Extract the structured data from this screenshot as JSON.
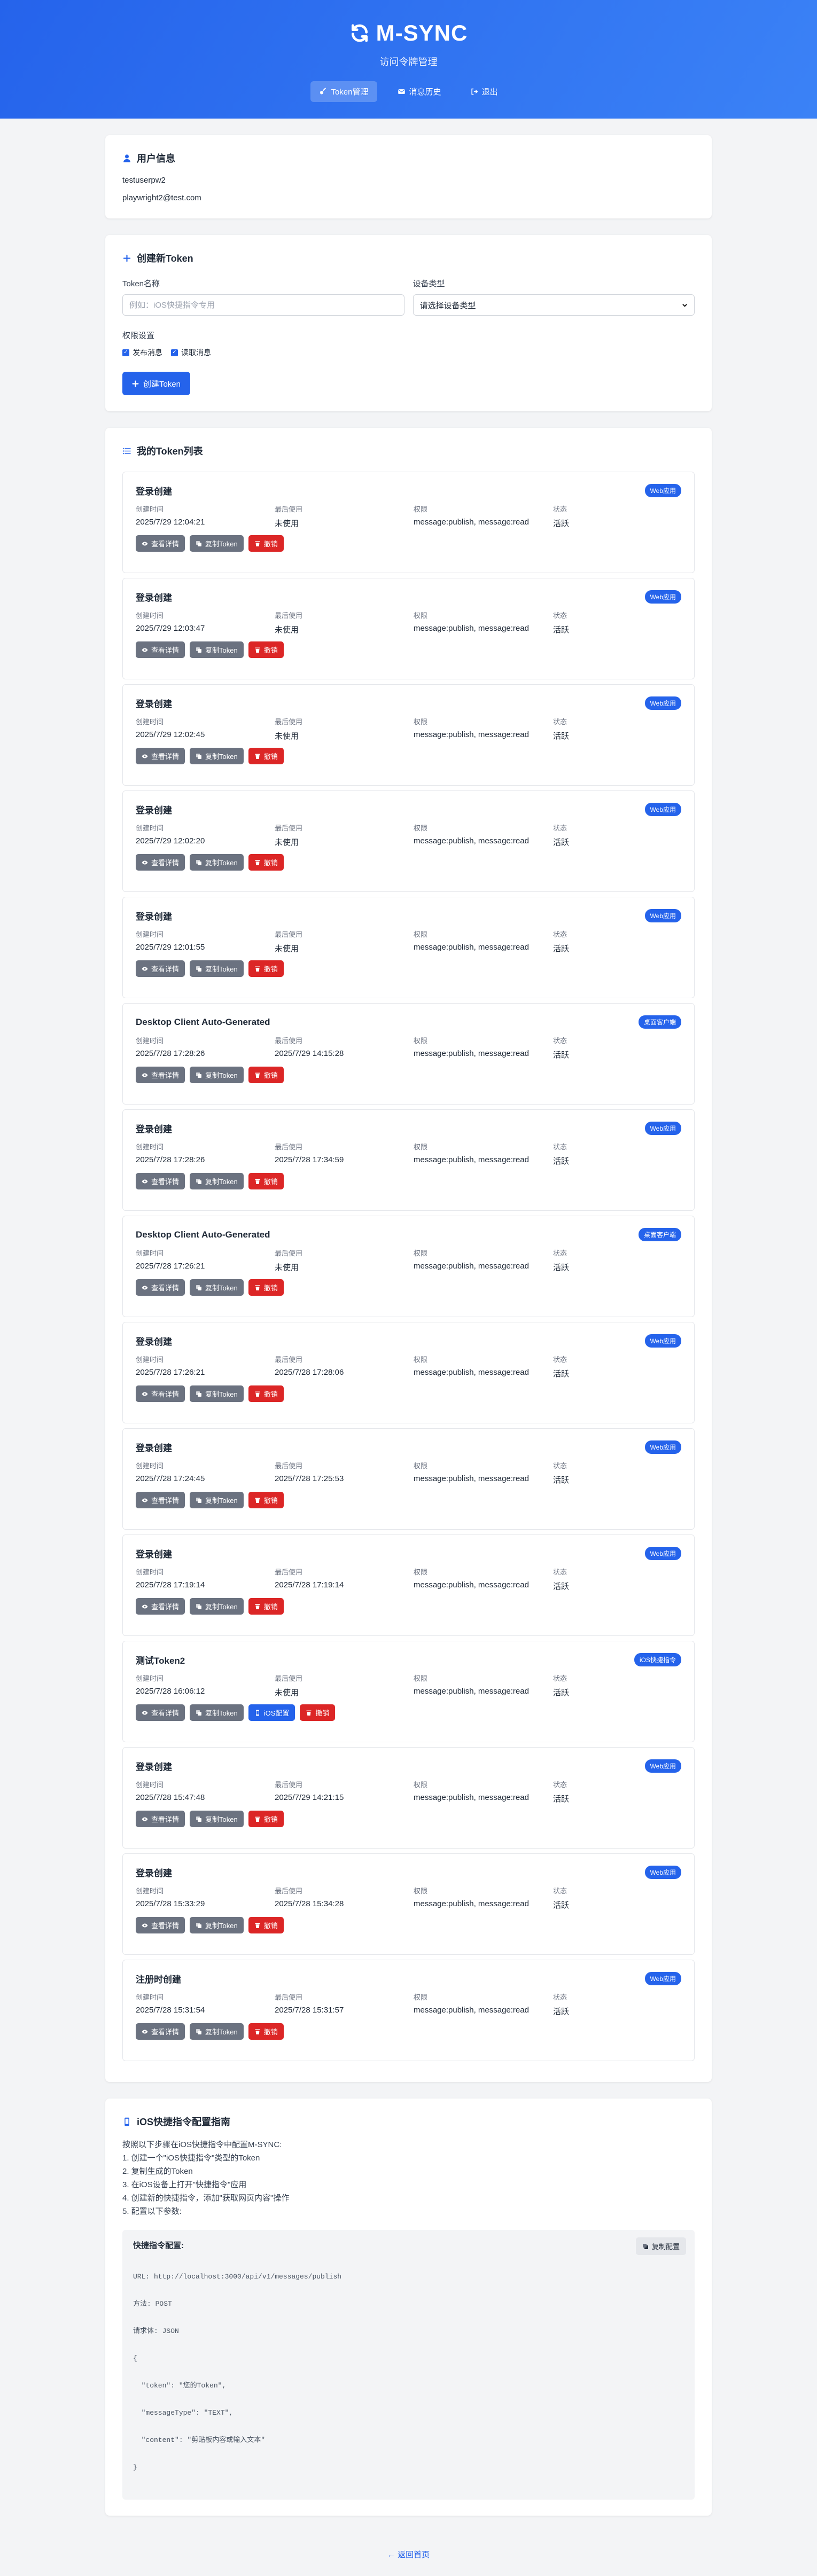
{
  "brand": {
    "name": "M-SYNC",
    "subtitle": "访问令牌管理"
  },
  "nav": {
    "items": [
      {
        "label": "Token管理",
        "icon": "key-icon",
        "active": true
      },
      {
        "label": "消息历史",
        "icon": "envelope-icon",
        "active": false
      },
      {
        "label": "退出",
        "icon": "logout-icon",
        "active": false
      }
    ]
  },
  "user": {
    "title": "用户信息",
    "username": "testuserpw2",
    "email": "playwright2@test.com"
  },
  "create": {
    "title": "创建新Token",
    "name_label": "Token名称",
    "name_placeholder": "例如：iOS快捷指令专用",
    "device_label": "设备类型",
    "device_value": "请选择设备类型",
    "perm_label": "权限设置",
    "perm_publish": "发布消息",
    "perm_read": "读取消息",
    "submit_label": "创建Token"
  },
  "tokens": {
    "title": "我的Token列表",
    "labels": {
      "created": "创建时间",
      "last_used": "最后使用",
      "permissions": "权限",
      "status": "状态"
    },
    "buttons": {
      "details": "查看详情",
      "copy": "复制Token",
      "ios": "iOS配置",
      "revoke": "撤销"
    },
    "items": [
      {
        "name": "登录创建",
        "badge": "Web应用",
        "created": "2025/7/29 12:04:21",
        "last_used": "未使用",
        "permissions": "message:publish, message:read",
        "status": "活跃",
        "ios": false
      },
      {
        "name": "登录创建",
        "badge": "Web应用",
        "created": "2025/7/29 12:03:47",
        "last_used": "未使用",
        "permissions": "message:publish, message:read",
        "status": "活跃",
        "ios": false
      },
      {
        "name": "登录创建",
        "badge": "Web应用",
        "created": "2025/7/29 12:02:45",
        "last_used": "未使用",
        "permissions": "message:publish, message:read",
        "status": "活跃",
        "ios": false
      },
      {
        "name": "登录创建",
        "badge": "Web应用",
        "created": "2025/7/29 12:02:20",
        "last_used": "未使用",
        "permissions": "message:publish, message:read",
        "status": "活跃",
        "ios": false
      },
      {
        "name": "登录创建",
        "badge": "Web应用",
        "created": "2025/7/29 12:01:55",
        "last_used": "未使用",
        "permissions": "message:publish, message:read",
        "status": "活跃",
        "ios": false
      },
      {
        "name": "Desktop Client Auto-Generated",
        "badge": "桌面客户端",
        "created": "2025/7/28 17:28:26",
        "last_used": "2025/7/29 14:15:28",
        "permissions": "message:publish, message:read",
        "status": "活跃",
        "ios": false
      },
      {
        "name": "登录创建",
        "badge": "Web应用",
        "created": "2025/7/28 17:28:26",
        "last_used": "2025/7/28 17:34:59",
        "permissions": "message:publish, message:read",
        "status": "活跃",
        "ios": false
      },
      {
        "name": "Desktop Client Auto-Generated",
        "badge": "桌面客户端",
        "created": "2025/7/28 17:26:21",
        "last_used": "未使用",
        "permissions": "message:publish, message:read",
        "status": "活跃",
        "ios": false
      },
      {
        "name": "登录创建",
        "badge": "Web应用",
        "created": "2025/7/28 17:26:21",
        "last_used": "2025/7/28 17:28:06",
        "permissions": "message:publish, message:read",
        "status": "活跃",
        "ios": false
      },
      {
        "name": "登录创建",
        "badge": "Web应用",
        "created": "2025/7/28 17:24:45",
        "last_used": "2025/7/28 17:25:53",
        "permissions": "message:publish, message:read",
        "status": "活跃",
        "ios": false
      },
      {
        "name": "登录创建",
        "badge": "Web应用",
        "created": "2025/7/28 17:19:14",
        "last_used": "2025/7/28 17:19:14",
        "permissions": "message:publish, message:read",
        "status": "活跃",
        "ios": false
      },
      {
        "name": "测试Token2",
        "badge": "iOS快捷指令",
        "created": "2025/7/28 16:06:12",
        "last_used": "未使用",
        "permissions": "message:publish, message:read",
        "status": "活跃",
        "ios": true
      },
      {
        "name": "登录创建",
        "badge": "Web应用",
        "created": "2025/7/28 15:47:48",
        "last_used": "2025/7/29 14:21:15",
        "permissions": "message:publish, message:read",
        "status": "活跃",
        "ios": false
      },
      {
        "name": "登录创建",
        "badge": "Web应用",
        "created": "2025/7/28 15:33:29",
        "last_used": "2025/7/28 15:34:28",
        "permissions": "message:publish, message:read",
        "status": "活跃",
        "ios": false
      },
      {
        "name": "注册时创建",
        "badge": "Web应用",
        "created": "2025/7/28 15:31:54",
        "last_used": "2025/7/28 15:31:57",
        "permissions": "message:publish, message:read",
        "status": "活跃",
        "ios": false
      }
    ]
  },
  "guide": {
    "title": "iOS快捷指令配置指南",
    "intro": "按照以下步骤在iOS快捷指令中配置M-SYNC:",
    "steps": [
      "1. 创建一个\"iOS快捷指令\"类型的Token",
      "2. 复制生成的Token",
      "3. 在iOS设备上打开\"快捷指令\"应用",
      "4. 创建新的快捷指令，添加\"获取网页内容\"操作",
      "5. 配置以下参数:"
    ],
    "code_title": "快捷指令配置:",
    "copy_label": "复制配置",
    "code_lines": [
      "URL: http://localhost:3000/api/v1/messages/publish",
      "方法: POST",
      "请求体: JSON",
      "{",
      "  \"token\": \"您的Token\",",
      "  \"messageType\": \"TEXT\",",
      "  \"content\": \"剪贴板内容或输入文本\"",
      "}"
    ]
  },
  "footer": {
    "back_label": "← 返回首页"
  }
}
